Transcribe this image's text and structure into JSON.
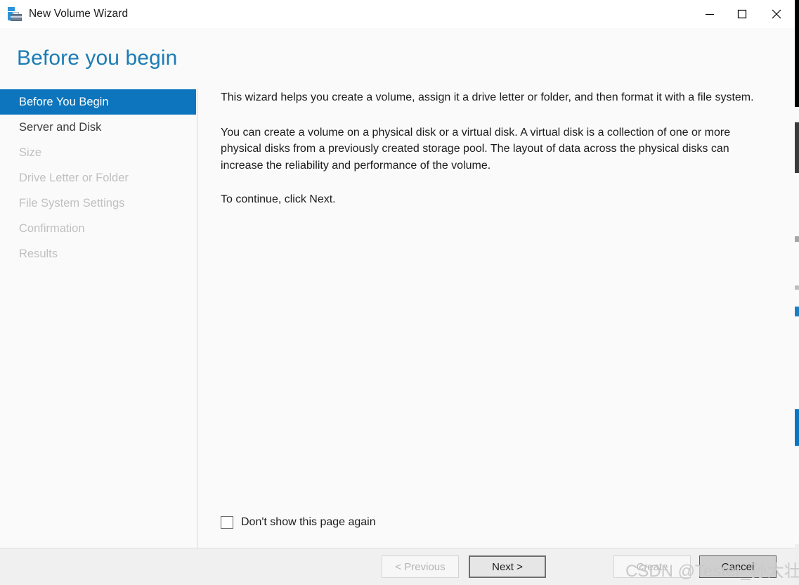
{
  "window": {
    "title": "New Volume Wizard",
    "app_icon": "volume-wizard-icon",
    "controls": {
      "minimize": "minimize-icon",
      "maximize": "maximize-icon",
      "close": "close-icon"
    }
  },
  "page": {
    "heading": "Before you begin"
  },
  "nav": {
    "items": [
      {
        "label": "Before You Begin",
        "state": "selected"
      },
      {
        "label": "Server and Disk",
        "state": "enabled"
      },
      {
        "label": "Size",
        "state": "disabled"
      },
      {
        "label": "Drive Letter or Folder",
        "state": "disabled"
      },
      {
        "label": "File System Settings",
        "state": "disabled"
      },
      {
        "label": "Confirmation",
        "state": "disabled"
      },
      {
        "label": "Results",
        "state": "disabled"
      }
    ]
  },
  "content": {
    "paragraphs": [
      "This wizard helps you create a volume, assign it a drive letter or folder, and then format it with a file system.",
      "You can create a volume on a physical disk or a virtual disk. A virtual disk is a collection of one or more physical disks from a previously created storage pool. The layout of data across the physical disks can increase the reliability and performance of the volume.",
      "To continue, click Next."
    ],
    "checkbox": {
      "label": "Don't show this page again",
      "checked": false
    }
  },
  "footer": {
    "buttons": [
      {
        "label": "< Previous",
        "state": "disabled"
      },
      {
        "label": "Next >",
        "state": "default"
      },
      {
        "label": "Create",
        "state": "disabled"
      },
      {
        "label": "Cancel",
        "state": "hover"
      }
    ]
  },
  "overlay": {
    "watermark": "CSDN @Tester_孙大壮"
  },
  "colors": {
    "accent_blue": "#0c75bd",
    "heading_blue": "#1b7cb5",
    "window_bg": "#fafafa",
    "footer_bg": "#f0f0f0",
    "disabled_text": "#c0c0c0"
  }
}
